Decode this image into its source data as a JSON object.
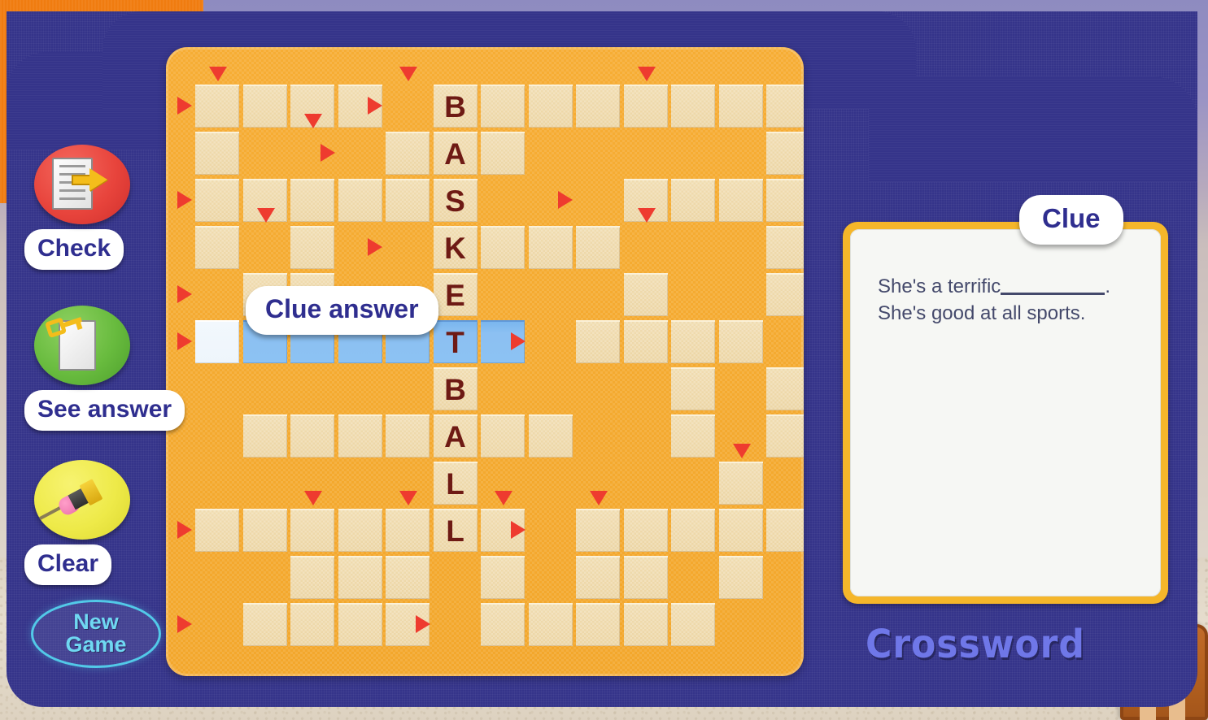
{
  "app": {
    "title": "Crossword"
  },
  "toolbar": {
    "buttons": [
      {
        "label": "Check",
        "icon": "document-arrow-icon",
        "color": "#e8443c"
      },
      {
        "label": "See answer",
        "icon": "key-document-icon",
        "color": "#68bb3e"
      },
      {
        "label": "Clear",
        "icon": "pencil-eraser-icon",
        "color": "#eeea49"
      }
    ],
    "new_game": {
      "line1": "New",
      "line2": "Game"
    }
  },
  "tooltips": {
    "clue_answer": "Clue answer",
    "clue": "Clue"
  },
  "clue": {
    "line1_before": "She's a terrific",
    "line1_after": ".",
    "line2": "She's good at all sports."
  },
  "board": {
    "columns": 13,
    "rows": 13,
    "answer_word": "BASKETBALL",
    "letters": [
      {
        "row": 0,
        "col": 5,
        "letter": "B"
      },
      {
        "row": 1,
        "col": 5,
        "letter": "A"
      },
      {
        "row": 2,
        "col": 5,
        "letter": "S"
      },
      {
        "row": 3,
        "col": 5,
        "letter": "K"
      },
      {
        "row": 4,
        "col": 5,
        "letter": "E"
      },
      {
        "row": 5,
        "col": 5,
        "letter": "T"
      },
      {
        "row": 6,
        "col": 5,
        "letter": "B"
      },
      {
        "row": 7,
        "col": 5,
        "letter": "A"
      },
      {
        "row": 8,
        "col": 5,
        "letter": "L"
      },
      {
        "row": 9,
        "col": 5,
        "letter": "L"
      }
    ],
    "cells": [
      [
        0,
        0
      ],
      [
        0,
        1
      ],
      [
        0,
        2
      ],
      [
        0,
        3
      ],
      [
        0,
        5
      ],
      [
        0,
        6
      ],
      [
        0,
        7
      ],
      [
        0,
        8
      ],
      [
        0,
        9
      ],
      [
        0,
        10
      ],
      [
        0,
        11
      ],
      [
        0,
        12
      ],
      [
        1,
        0
      ],
      [
        1,
        4
      ],
      [
        1,
        5
      ],
      [
        1,
        6
      ],
      [
        1,
        12
      ],
      [
        2,
        0
      ],
      [
        2,
        1
      ],
      [
        2,
        2
      ],
      [
        2,
        3
      ],
      [
        2,
        4
      ],
      [
        2,
        5
      ],
      [
        2,
        9
      ],
      [
        2,
        10
      ],
      [
        2,
        11
      ],
      [
        2,
        12
      ],
      [
        3,
        0
      ],
      [
        3,
        2
      ],
      [
        3,
        5
      ],
      [
        3,
        6
      ],
      [
        3,
        7
      ],
      [
        3,
        8
      ],
      [
        3,
        12
      ],
      [
        4,
        1
      ],
      [
        4,
        2
      ],
      [
        4,
        5
      ],
      [
        4,
        9
      ],
      [
        4,
        12
      ],
      [
        5,
        0
      ],
      [
        5,
        1
      ],
      [
        5,
        2
      ],
      [
        5,
        3
      ],
      [
        5,
        4
      ],
      [
        5,
        5
      ],
      [
        5,
        6
      ],
      [
        5,
        8
      ],
      [
        5,
        9
      ],
      [
        5,
        10
      ],
      [
        5,
        11
      ],
      [
        6,
        5
      ],
      [
        6,
        10
      ],
      [
        6,
        12
      ],
      [
        7,
        1
      ],
      [
        7,
        2
      ],
      [
        7,
        3
      ],
      [
        7,
        4
      ],
      [
        7,
        5
      ],
      [
        7,
        6
      ],
      [
        7,
        7
      ],
      [
        7,
        10
      ],
      [
        7,
        12
      ],
      [
        8,
        5
      ],
      [
        8,
        11
      ],
      [
        9,
        0
      ],
      [
        9,
        1
      ],
      [
        9,
        2
      ],
      [
        9,
        3
      ],
      [
        9,
        4
      ],
      [
        9,
        5
      ],
      [
        9,
        6
      ],
      [
        9,
        8
      ],
      [
        9,
        9
      ],
      [
        9,
        10
      ],
      [
        9,
        11
      ],
      [
        9,
        12
      ],
      [
        10,
        2
      ],
      [
        10,
        3
      ],
      [
        10,
        4
      ],
      [
        10,
        6
      ],
      [
        10,
        8
      ],
      [
        10,
        9
      ],
      [
        10,
        11
      ],
      [
        11,
        1
      ],
      [
        11,
        2
      ],
      [
        11,
        3
      ],
      [
        11,
        4
      ],
      [
        11,
        6
      ],
      [
        11,
        7
      ],
      [
        11,
        8
      ],
      [
        11,
        9
      ],
      [
        11,
        10
      ]
    ],
    "highlighted_cells": [
      [
        5,
        1
      ],
      [
        5,
        2
      ],
      [
        5,
        3
      ],
      [
        5,
        4
      ],
      [
        5,
        5
      ],
      [
        5,
        6
      ]
    ],
    "cursor_cell": [
      5,
      0
    ],
    "markers": [
      {
        "row": 0,
        "col": 0,
        "dir": "down"
      },
      {
        "row": 0,
        "col": 0,
        "dir": "right"
      },
      {
        "row": 0,
        "col": 4,
        "dir": "right"
      },
      {
        "row": 0,
        "col": 4,
        "dir": "down"
      },
      {
        "row": 0,
        "col": 9,
        "dir": "down"
      },
      {
        "row": 1,
        "col": 3,
        "dir": "right"
      },
      {
        "row": 1,
        "col": 2,
        "dir": "down"
      },
      {
        "row": 2,
        "col": 0,
        "dir": "right"
      },
      {
        "row": 2,
        "col": 8,
        "dir": "right"
      },
      {
        "row": 3,
        "col": 4,
        "dir": "right"
      },
      {
        "row": 3,
        "col": 1,
        "dir": "down"
      },
      {
        "row": 3,
        "col": 9,
        "dir": "down"
      },
      {
        "row": 4,
        "col": 0,
        "dir": "right"
      },
      {
        "row": 5,
        "col": 0,
        "dir": "right"
      },
      {
        "row": 5,
        "col": 7,
        "dir": "right"
      },
      {
        "row": 8,
        "col": 11,
        "dir": "down"
      },
      {
        "row": 9,
        "col": 0,
        "dir": "right"
      },
      {
        "row": 9,
        "col": 2,
        "dir": "down"
      },
      {
        "row": 9,
        "col": 4,
        "dir": "down"
      },
      {
        "row": 9,
        "col": 6,
        "dir": "down"
      },
      {
        "row": 9,
        "col": 8,
        "dir": "down"
      },
      {
        "row": 9,
        "col": 7,
        "dir": "right"
      },
      {
        "row": 11,
        "col": 0,
        "dir": "right"
      },
      {
        "row": 11,
        "col": 5,
        "dir": "right"
      }
    ]
  }
}
